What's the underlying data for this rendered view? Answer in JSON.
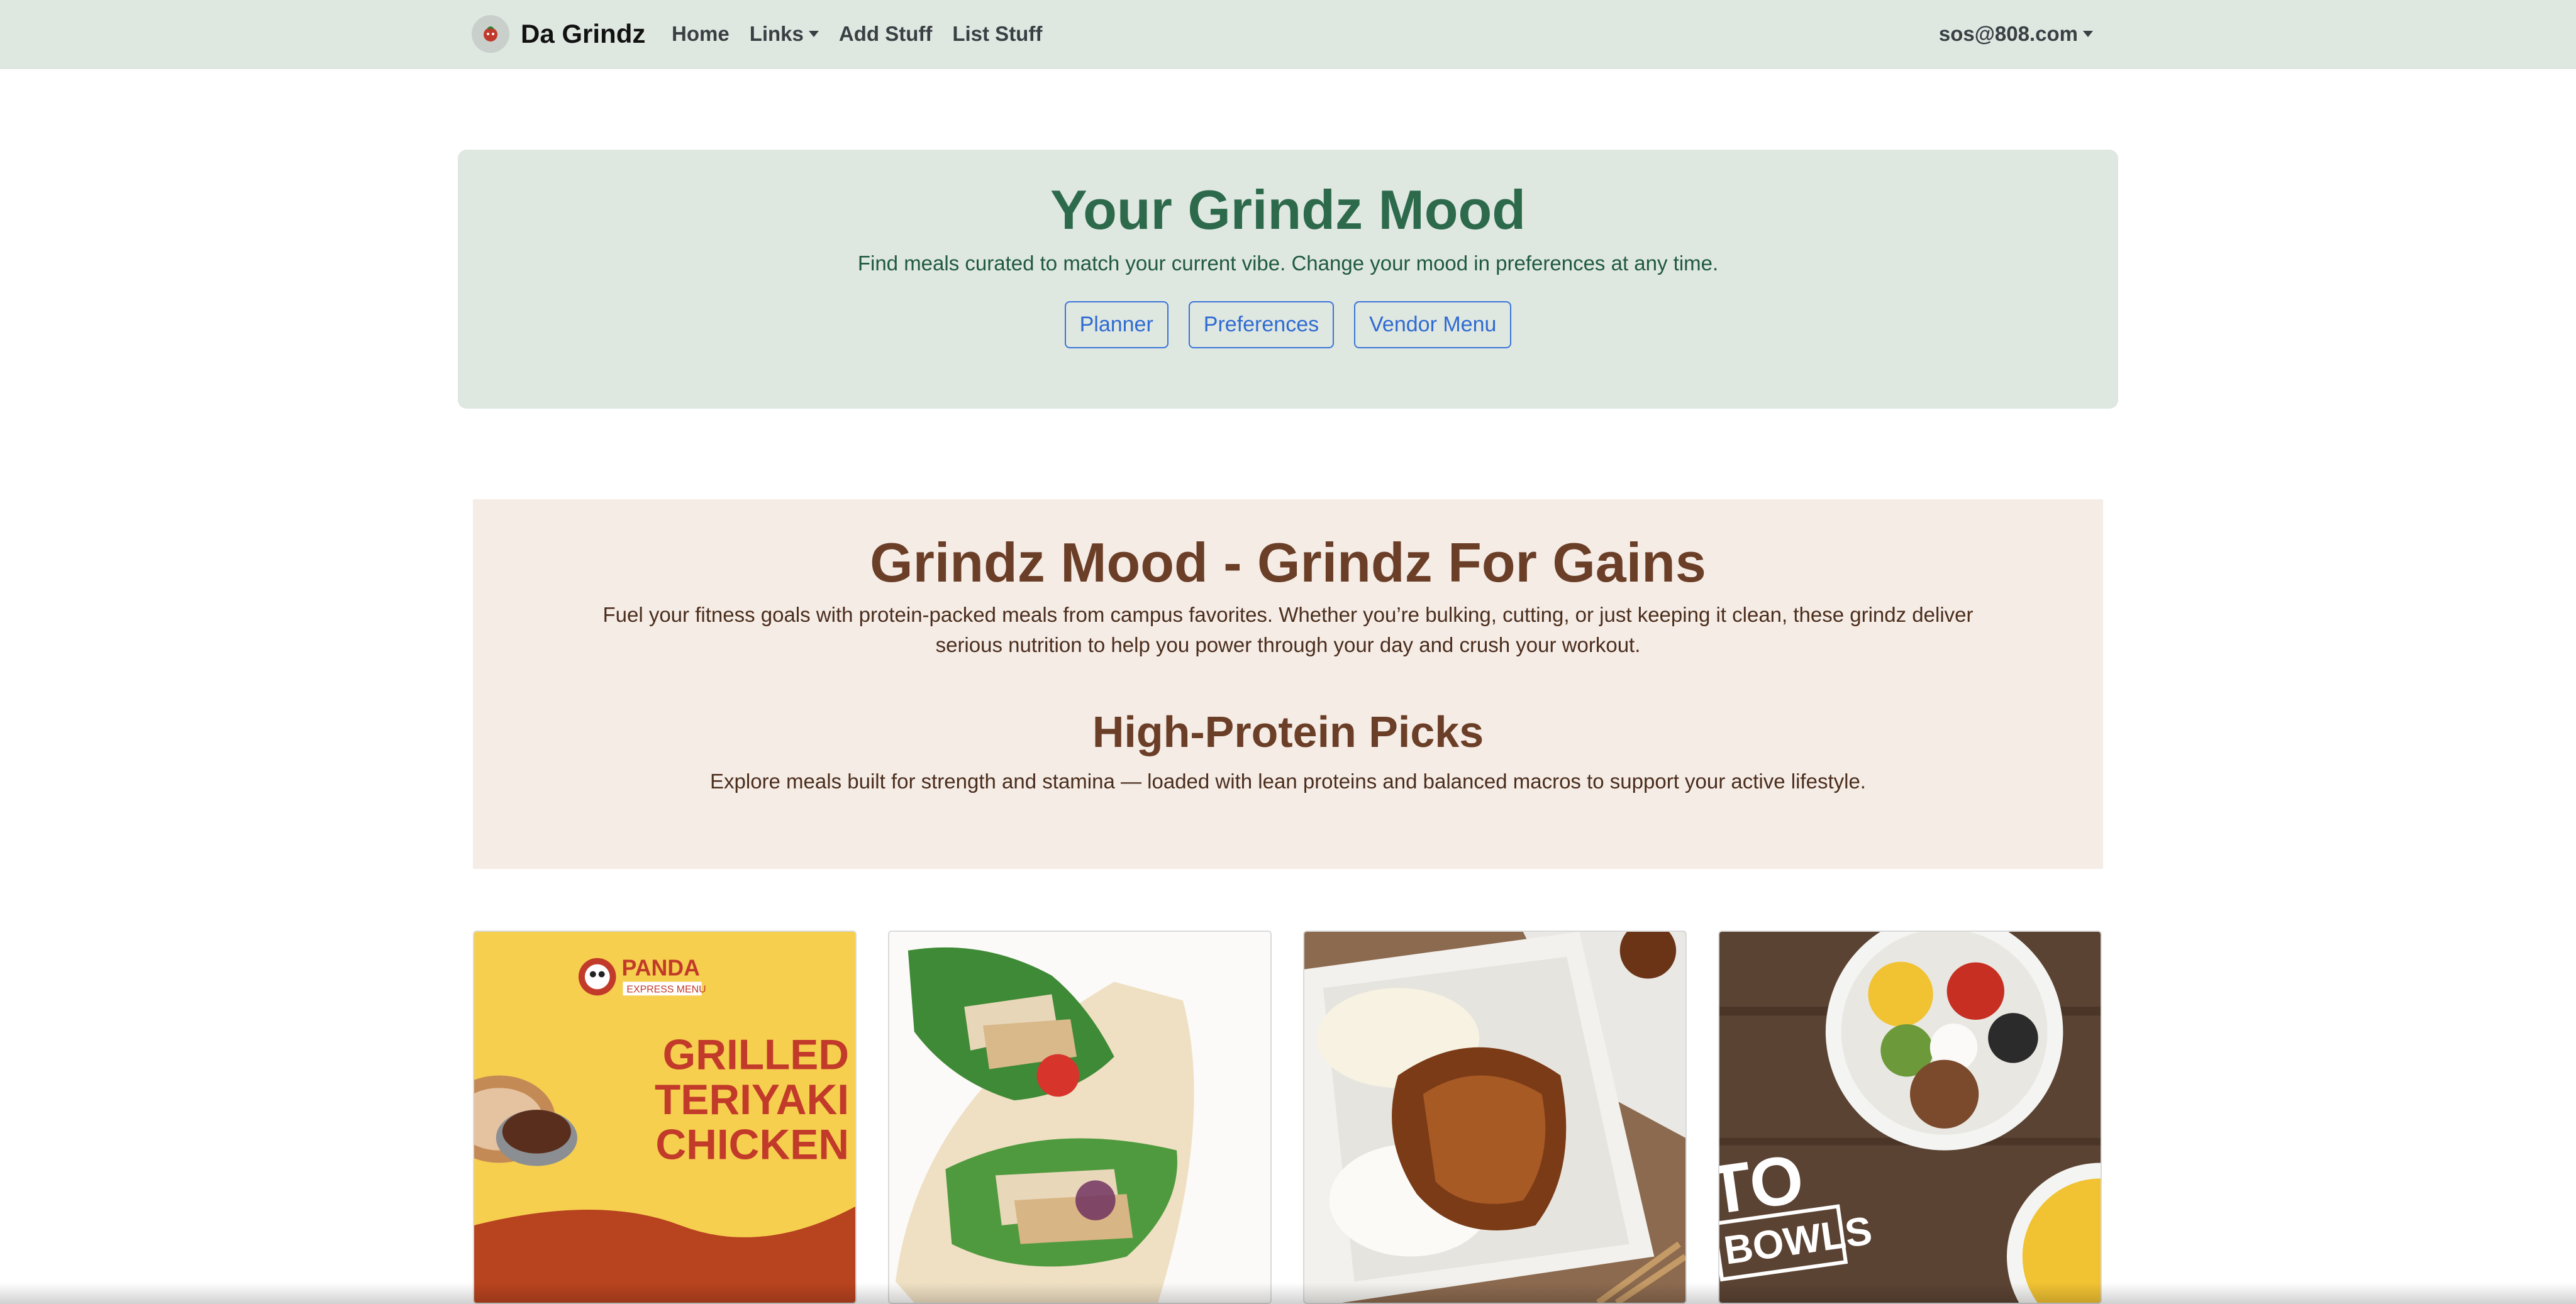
{
  "navbar": {
    "brand": "Da Grindz",
    "logo_icon": "chili-logo-icon",
    "links": [
      "Home",
      "Links",
      "Add Stuff",
      "List Stuff"
    ],
    "user": "sos@808.com"
  },
  "mood": {
    "title": "Your Grindz Mood",
    "subtitle": "Find meals curated to match your current vibe. Change your mood in preferences at any time.",
    "buttons": [
      "Planner",
      "Preferences",
      "Vendor Menu"
    ]
  },
  "gains": {
    "title": "Grindz Mood - Grindz For Gains",
    "description": "Fuel your fitness goals with protein-packed meals from campus favorites. Whether you’re bulking, cutting, or just keeping it clean, these grindz deliver serious nutrition to help you power through your day and crush your workout.",
    "picks_title": "High-Protein Picks",
    "picks_description": "Explore meals built for strength and stamina — loaded with lean proteins and balanced macros to support your active lifestyle."
  },
  "cards": [
    {
      "image": "panda-express-teriyaki-chicken-photo",
      "panda_brand": "PANDA",
      "panda_sub": "EXPRESS MENU",
      "promo_lines": [
        "GRILLED",
        "TERIYAKI",
        "CHICKEN"
      ]
    },
    {
      "image": "grilled-chicken-wrap-photo"
    },
    {
      "image": "teriyaki-chicken-plate-lunch-photo"
    },
    {
      "image": "burrito-bowls-photo",
      "promo_lines": [
        "TO",
        "BOWLS"
      ]
    }
  ],
  "colors": {
    "navbar_bg": "#dfe7e1",
    "mood_bg": "#dfe7e1",
    "mood_title": "#2d6a4c",
    "button_outline": "#3874d8",
    "gains_bg": "#f5ece6",
    "gains_title": "#6b3e27"
  }
}
